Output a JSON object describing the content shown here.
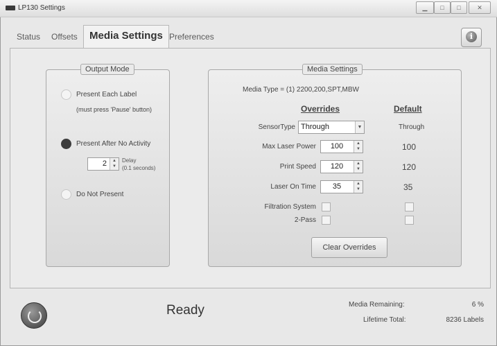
{
  "window": {
    "title": "LP130 Settings",
    "controls": [
      "minimize",
      "maximize",
      "close"
    ]
  },
  "tabs": [
    {
      "label": "Status"
    },
    {
      "label": "Offsets"
    },
    {
      "label": "Media Settings",
      "active": true
    },
    {
      "label": "Preferences"
    }
  ],
  "info_button": {
    "glyph": "i",
    "icon": "info-icon"
  },
  "output_mode": {
    "legend": "Output Mode",
    "present_each_label": "Present Each Label",
    "present_each_note": "(must press 'Pause' button)",
    "present_after": "Present After No Activity",
    "delay_value": "2",
    "delay_label": "Delay",
    "delay_units": "(0.1 seconds)",
    "do_not_present": "Do Not Present",
    "selected": "Present After No Activity"
  },
  "media_settings": {
    "legend": "Media Settings",
    "media_type": "Media Type = (1) 2200,200,SPT,MBW",
    "overrides_header": "Overrides",
    "default_header": "Default",
    "sensor_type_label": "SensorType",
    "sensor_type_value": "Through",
    "sensor_type_default": "Through",
    "max_laser_power_label": "Max Laser Power",
    "max_laser_power_value": "100",
    "max_laser_power_default": "100",
    "print_speed_label": "Print Speed",
    "print_speed_value": "120",
    "print_speed_default": "120",
    "laser_on_time_label": "Laser On Time",
    "laser_on_time_value": "35",
    "laser_on_time_default": "35",
    "filtration_label": "Filtration System",
    "two_pass_label": "2-Pass",
    "clear_button": "Clear Overrides"
  },
  "status_bar": {
    "status_text": "Ready",
    "media_remaining_label": "Media Remaining:",
    "media_remaining_value": "6 %",
    "lifetime_total_label": "Lifetime Total:",
    "lifetime_total_value": "8236 Labels"
  }
}
